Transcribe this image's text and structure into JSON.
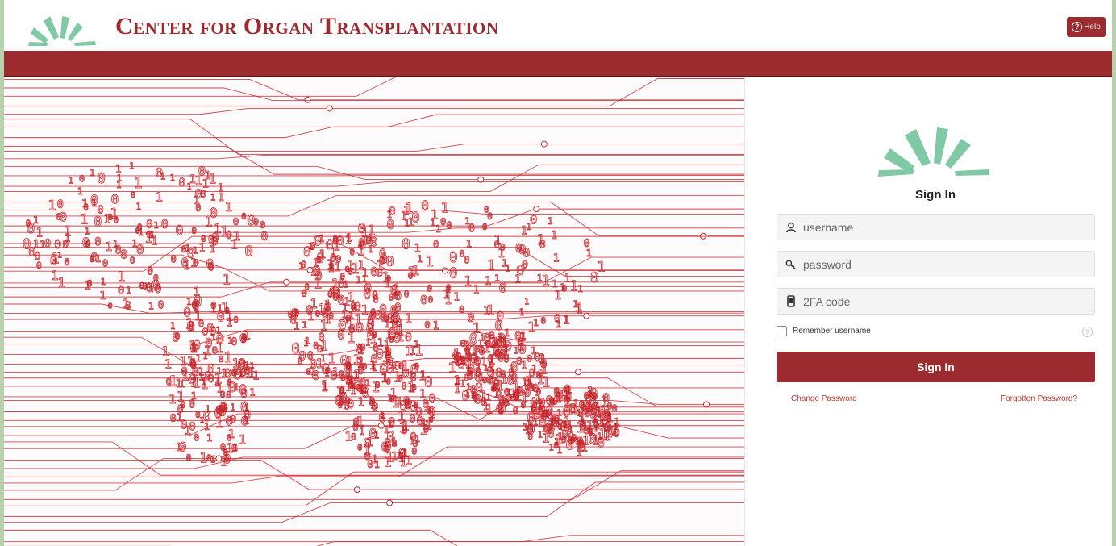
{
  "header": {
    "title": "Center for Organ Transplantation",
    "help_label": "Help",
    "help_icon": "question-circle-icon"
  },
  "colors": {
    "brand": "#9b2b2e",
    "logo": "#7fc9a4",
    "page_frame": "#b7d1ae"
  },
  "login": {
    "title": "Sign In",
    "username_placeholder": "username",
    "password_placeholder": "password",
    "twofa_placeholder": "2FA code",
    "remember_label": "Remember username",
    "signin_label": "Sign In",
    "change_password_label": "Change Password",
    "forgotten_password_label": "Forgotten Password?"
  }
}
